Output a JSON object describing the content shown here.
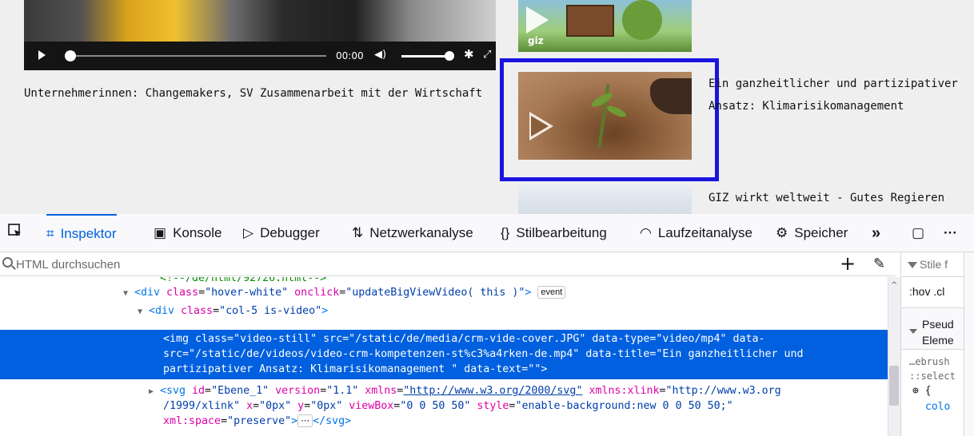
{
  "page": {
    "video_time": "00:00",
    "caption_left": "Unternehmerinnen: Changemakers, SV Zusammenarbeit mit der Wirtschaft",
    "caption_right": "Ein ganzheitlicher und partizipativer Ansatz: Klimarisikomanagement",
    "caption_bottom": "GIZ wirkt weltweit - Gutes Regieren",
    "thumb_top_label": "giz",
    "highlight_color": "#1b14e0"
  },
  "devtools": {
    "tabs": [
      {
        "label": "Inspektor",
        "icon": "inspector-icon",
        "active": true
      },
      {
        "label": "Konsole",
        "icon": "console-icon"
      },
      {
        "label": "Debugger",
        "icon": "debugger-icon"
      },
      {
        "label": "Netzwerkanalyse",
        "icon": "network-icon"
      },
      {
        "label": "Stilbearbeitung",
        "icon": "style-editor-icon"
      },
      {
        "label": "Laufzeitanalyse",
        "icon": "performance-icon"
      },
      {
        "label": "Speicher",
        "icon": "memory-icon"
      }
    ],
    "more_tabs": "»",
    "overflow_menu": "···",
    "search_placeholder": "HTML durchsuchen",
    "accent_color": "#0061e0",
    "selection_color": "#0060df"
  },
  "markup": {
    "comment": "<!--/de/html/92726.html-->",
    "line1": {
      "tag_open": "<div ",
      "attr1": "class",
      "val1": "\"hover-white\"",
      "attr2": "onclick",
      "val2": "\"updateBigViewVideo( this )\"",
      "tag_close": ">",
      "badge": "event"
    },
    "line2": {
      "tag_open": "<div ",
      "attr1": "class",
      "val1": "\"col-5 is-video\"",
      "tag_close": ">"
    },
    "selected": [
      "<img class=\"video-still\" src=\"/static/de/media/crm-vide-cover.JPG\" data-type=\"video/mp4\" data-",
      "src=\"/static/de/videos/video-crm-kompetenzen-st%c3%a4rken-de.mp4\" data-title=\"Ein ganzheitlicher und",
      "partizipativer Ansatz: Klimarisikomanagement \" data-text=\"\">"
    ],
    "svg_line1": {
      "tag_open": "<svg ",
      "a1": "id",
      "v1": "\"Ebene_1\"",
      "a2": "version",
      "v2": "\"1.1\"",
      "a3": "xmlns",
      "v3": "\"http://www.w3.org/2000/svg\"",
      "a4": "xmlns:xlink",
      "v4": "\"http://www.w3.org"
    },
    "svg_line2": {
      "v4b": "/1999/xlink\"",
      "a5": "x",
      "v5": "\"0px\"",
      "a6": "y",
      "v6": "\"0px\"",
      "a7": "viewBox",
      "v7": "\"0 0 50 50\"",
      "a8": "style",
      "v8": "\"enable-background:new 0 0 50 50;\""
    },
    "svg_line3": {
      "a9": "xml:space",
      "v9": "\"preserve\"",
      "tag_close": ">",
      "ellipsis": "⋯",
      "end_tag": "</svg>"
    }
  },
  "rules": {
    "filter_placeholder": "Stile f",
    "hov_cls": ":hov .cl",
    "pseudo_line1": "Pseud",
    "pseudo_line2": "Eleme",
    "source_line1": "…ebrush",
    "source_line2": "::select",
    "rule_open": "{",
    "rule_prop": "colo"
  }
}
